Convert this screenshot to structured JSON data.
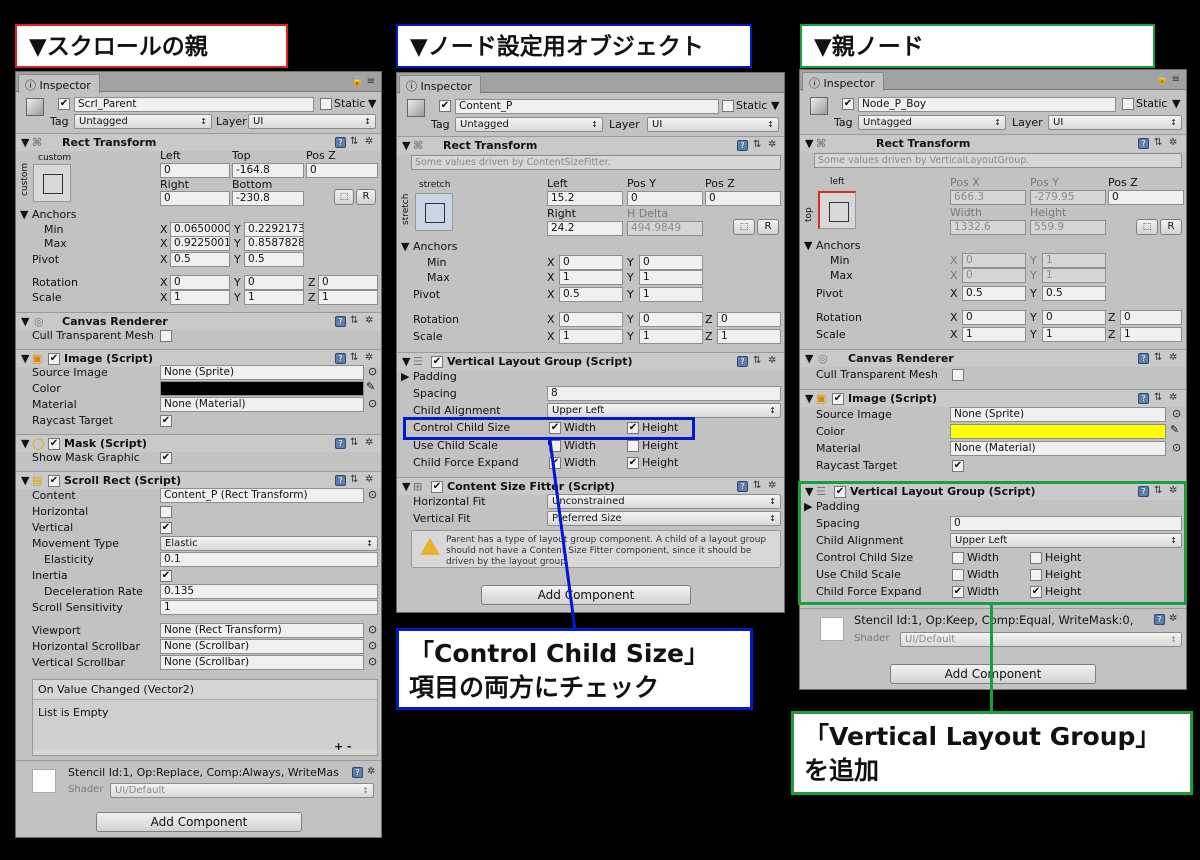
{
  "titles": {
    "left": "▼スクロールの親",
    "mid": "▼ノード設定用オブジェクト",
    "right": "▼親ノード"
  },
  "common": {
    "inspector": "Inspector",
    "static": "Static",
    "tag": "Tag",
    "layer": "Layer",
    "untagged": "Untagged",
    "ui": "UI",
    "add_component": "Add Component",
    "shader": "Shader",
    "ui_default": "UI/Default",
    "rect_transform": "Rect Transform",
    "anchors": "Anchors",
    "min": "Min",
    "max": "Max",
    "pivot": "Pivot",
    "rotation": "Rotation",
    "scale": "Scale",
    "x": "X",
    "y": "Y",
    "z": "Z",
    "r": "R"
  },
  "left": {
    "name": "Scrl_Parent",
    "anchor_preset": "custom",
    "anchor_side": "custom",
    "col_left": "Left",
    "col_top": "Top",
    "col_posz": "Pos Z",
    "col_right": "Right",
    "col_bottom": "Bottom",
    "left_val": "0",
    "top_val": "-164.8",
    "posz_val": "0",
    "right_val": "0",
    "bottom_val": "-230.8",
    "min_x": "0.0650000",
    "min_y": "0.2292173",
    "max_x": "0.9225001",
    "max_y": "0.8587828",
    "pivot_x": "0.5",
    "pivot_y": "0.5",
    "rot_x": "0",
    "rot_y": "0",
    "rot_z": "0",
    "sc_x": "1",
    "sc_y": "1",
    "sc_z": "1",
    "canvas_renderer": "Canvas Renderer",
    "cull": "Cull Transparent Mesh",
    "image_script": "Image (Script)",
    "source_image": "Source Image",
    "source_val": "None (Sprite)",
    "color": "Color",
    "material": "Material",
    "material_val": "None (Material)",
    "raycast": "Raycast Target",
    "mask_script": "Mask (Script)",
    "show_mask": "Show Mask Graphic",
    "scroll_rect": "Scroll Rect (Script)",
    "content": "Content",
    "content_val": "Content_P (Rect Transform)",
    "horizontal": "Horizontal",
    "vertical": "Vertical",
    "movement": "Movement Type",
    "movement_val": "Elastic",
    "elasticity": "Elasticity",
    "elasticity_val": "0.1",
    "inertia": "Inertia",
    "decel": "Deceleration Rate",
    "decel_val": "0.135",
    "sensitivity": "Scroll Sensitivity",
    "sensitivity_val": "1",
    "viewport": "Viewport",
    "viewport_val": "None (Rect Transform)",
    "hscroll": "Horizontal Scrollbar",
    "hscroll_val": "None (Scrollbar)",
    "vscroll": "Vertical Scrollbar",
    "vscroll_val": "None (Scrollbar)",
    "on_value": "On Value Changed (Vector2)",
    "list_empty": "List is Empty",
    "plusminus": "+ -",
    "stencil": "Stencil Id:1, Op:Replace, Comp:Always, WriteMas"
  },
  "mid": {
    "name": "Content_P",
    "driven": "Some values driven by ContentSizeFitter.",
    "anchor_preset": "stretch",
    "anchor_side": "stretch",
    "col_left": "Left",
    "col_posy": "Pos Y",
    "col_posz": "Pos Z",
    "col_right": "Right",
    "col_hdelta": "H Delta",
    "left_val": "15.2",
    "posy_val": "0",
    "posz_val": "0",
    "right_val": "24.2",
    "hdelta_val": "494.9849",
    "min_x": "0",
    "min_y": "0",
    "max_x": "1",
    "max_y": "1",
    "pivot_x": "0.5",
    "pivot_y": "1",
    "rot_x": "0",
    "rot_y": "0",
    "rot_z": "0",
    "sc_x": "1",
    "sc_y": "1",
    "sc_z": "1",
    "vlg": "Vertical Layout Group (Script)",
    "padding": "Padding",
    "spacing": "Spacing",
    "spacing_val": "8",
    "child_align": "Child Alignment",
    "child_align_val": "Upper Left",
    "ccs": "Control Child Size",
    "ucs": "Use Child Scale",
    "cfe": "Child Force Expand",
    "width": "Width",
    "height": "Height",
    "csf": "Content Size Fitter (Script)",
    "hfit": "Horizontal Fit",
    "hfit_val": "Unconstrained",
    "vfit": "Vertical Fit",
    "vfit_val": "Preferred Size",
    "warning": "Parent has a type of layout group component. A child of a layout group should not have a Content Size Fitter component, since it should be driven by the layout group."
  },
  "right": {
    "name": "Node_P_Boy",
    "driven": "Some values driven by VerticalLayoutGroup.",
    "anchor_preset": "left",
    "anchor_side": "top",
    "col_posx": "Pos X",
    "col_posy": "Pos Y",
    "col_posz": "Pos Z",
    "col_width": "Width",
    "col_height": "Height",
    "posx_val": "666.3",
    "posy_val": "-279.95",
    "posz_val": "0",
    "width_val": "1332.6",
    "height_val": "559.9",
    "min_x": "0",
    "min_y": "1",
    "max_x": "0",
    "max_y": "1",
    "pivot_x": "0.5",
    "pivot_y": "0.5",
    "rot_x": "0",
    "rot_y": "0",
    "rot_z": "0",
    "sc_x": "1",
    "sc_y": "1",
    "sc_z": "1",
    "canvas_renderer": "Canvas Renderer",
    "cull": "Cull Transparent Mesh",
    "image_script": "Image (Script)",
    "source_image": "Source Image",
    "source_val": "None (Sprite)",
    "color": "Color",
    "material": "Material",
    "material_val": "None (Material)",
    "raycast": "Raycast Target",
    "vlg": "Vertical Layout Group (Script)",
    "padding": "Padding",
    "spacing": "Spacing",
    "spacing_val": "0",
    "child_align": "Child Alignment",
    "child_align_val": "Upper Left",
    "ccs": "Control Child Size",
    "ucs": "Use Child Scale",
    "cfe": "Child Force Expand",
    "width": "Width",
    "height": "Height",
    "stencil": "Stencil Id:1, Op:Keep, Comp:Equal, WriteMask:0,"
  },
  "notes": {
    "mid_1": "「Control Child Size」",
    "mid_2": "項目の両方にチェック",
    "right_1": "「Vertical Layout Group」",
    "right_2": "を追加"
  },
  "colors": {
    "red": "#e02020",
    "blue": "#0018d0",
    "green": "#18a040",
    "yellow": "#ffff00"
  }
}
